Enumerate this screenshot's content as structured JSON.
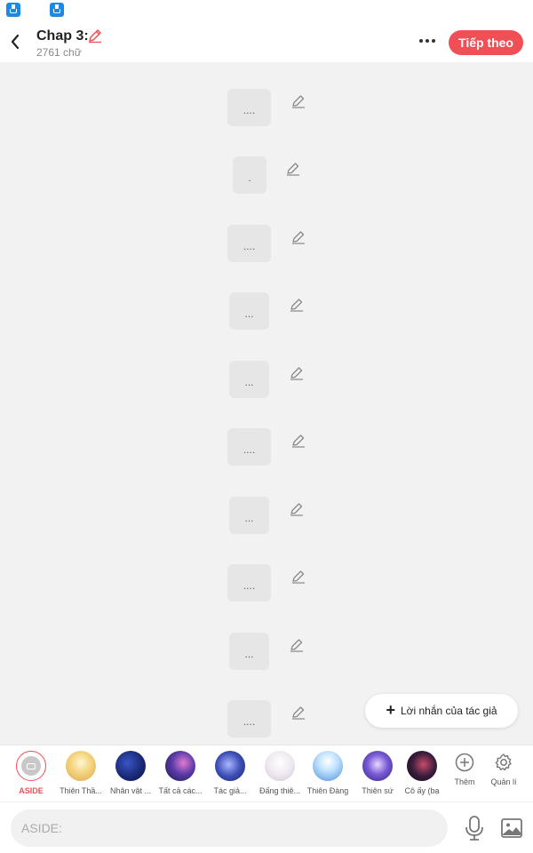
{
  "header": {
    "title": "Chap 3:",
    "word_count": "2761 chữ",
    "next_label": "Tiếp theo",
    "accent": "#ef4f55"
  },
  "messages": [
    {
      "text": "...."
    },
    {
      "text": "."
    },
    {
      "text": "...."
    },
    {
      "text": "..."
    },
    {
      "text": "..."
    },
    {
      "text": "...."
    },
    {
      "text": "..."
    },
    {
      "text": "...."
    },
    {
      "text": "..."
    },
    {
      "text": "...."
    }
  ],
  "author_note_label": "Lời nhắn của tác giả",
  "characters": [
    {
      "name": "ASIDE",
      "selected": true
    },
    {
      "name": "Thiên Thầ..."
    },
    {
      "name": "Nhân vật ..."
    },
    {
      "name": "Tất cả các..."
    },
    {
      "name": "Tác giả..."
    },
    {
      "name": "Đấng thiê..."
    },
    {
      "name": "Thiên Đàng"
    },
    {
      "name": "Thiên sứ"
    },
    {
      "name": "Cô ấy (bạ"
    }
  ],
  "tools": {
    "add_label": "Thêm",
    "manage_label": "Quản lí"
  },
  "input": {
    "placeholder": "ASIDE:"
  }
}
